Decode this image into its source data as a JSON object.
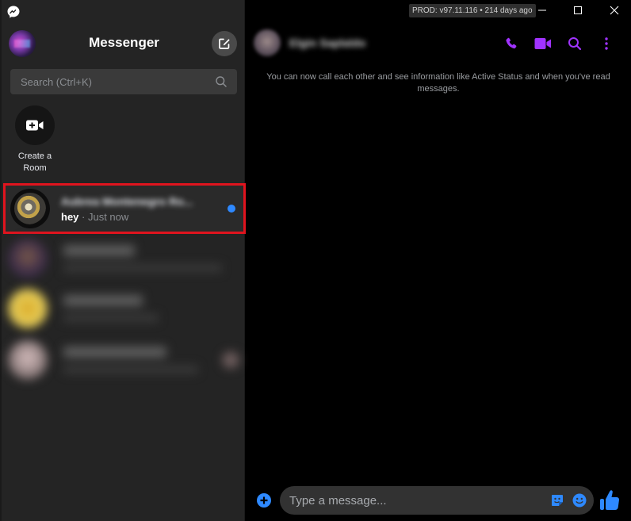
{
  "app": {
    "title": "Messenger",
    "version_badge": "PROD: v97.11.116 • 214 days ago"
  },
  "window_controls": [
    "minimize",
    "maximize",
    "close"
  ],
  "sidebar": {
    "search": {
      "placeholder": "Search (Ctrl+K)",
      "value": ""
    },
    "create_room_label": "Create a Room",
    "conversations": [
      {
        "name": "Aubrea Montenegro Ro...",
        "snippet_bold": "hey",
        "snippet_rest": " · Just now",
        "unread": true,
        "selected": true
      },
      {
        "name": "[blurred]",
        "selected": false
      },
      {
        "name": "[blurred]",
        "selected": false
      },
      {
        "name": "[blurred]",
        "selected": false
      }
    ]
  },
  "chat": {
    "contact_name": "Elgin Saplaldo",
    "notice": "You can now call each other and see information like Active Status and when you've read messages.",
    "header_icons": [
      "phone-icon",
      "video-call-icon",
      "search-icon",
      "more-icon"
    ],
    "composer": {
      "placeholder": "Type a message...",
      "value": ""
    }
  },
  "colors": {
    "accent_purple": "#a033ff",
    "accent_blue": "#2e89ff",
    "selection_border": "#e0141e",
    "sidebar_bg": "#242424",
    "chat_bg": "#000000"
  }
}
